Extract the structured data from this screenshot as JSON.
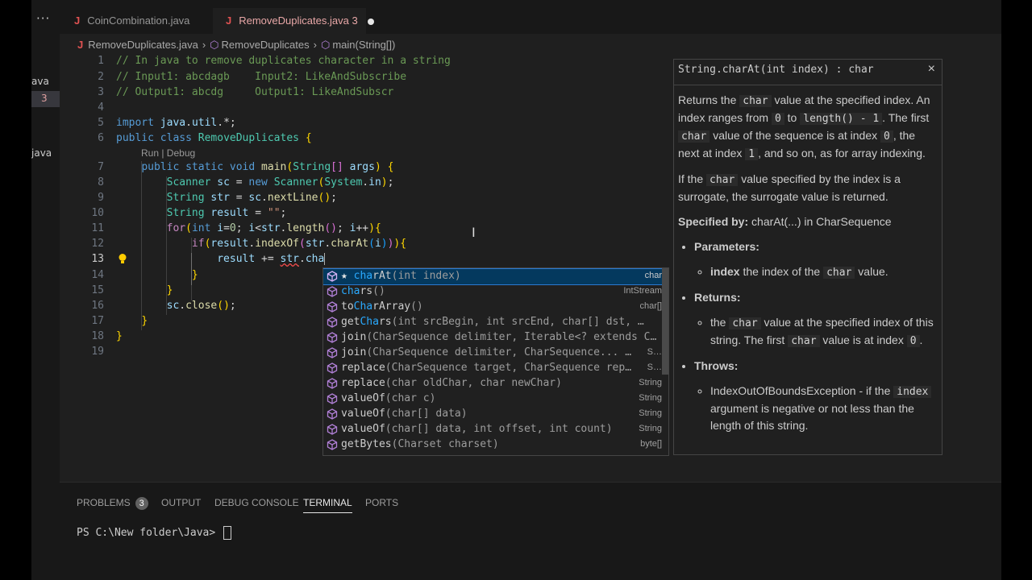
{
  "sidebar": {
    "more": "···",
    "items": [
      "ava",
      "3",
      "java"
    ]
  },
  "tabs": [
    {
      "label": "CoinCombination.java",
      "badge": ""
    },
    {
      "label": "RemoveDuplicates.java",
      "badge": "3"
    }
  ],
  "breadcrumb": {
    "file": "RemoveDuplicates.java",
    "class": "RemoveDuplicates",
    "method": "main(String[])"
  },
  "editor": {
    "line_numbers": [
      "1",
      "2",
      "3",
      "4",
      "5",
      "6",
      "7",
      "8",
      "9",
      "10",
      "11",
      "12",
      "13",
      "14",
      "15",
      "16",
      "17",
      "18",
      "19"
    ],
    "lines": [
      "// In java to remove duplicates character in a string",
      "// Input1: abcdagb    Input2: LikeAndSubscribe",
      "// Output1: abcdg     Output1: LikeAndSubscr",
      "",
      "import java.util.*;",
      "public class RemoveDuplicates {",
      "    public static void main(String[] args) {",
      "        Scanner sc = new Scanner(System.in);",
      "        String str = sc.nextLine();",
      "        String result = \"\";",
      "        for(int i=0; i<str.length(); i++){",
      "            if(result.indexOf(str.charAt(i))){",
      "                result += str.cha",
      "            }",
      "        }",
      "        sc.close();",
      "    }",
      "}",
      ""
    ],
    "codelens": "Run | Debug"
  },
  "suggest": {
    "items": [
      {
        "match": "charAt",
        "rest": "(int index)",
        "type": "char",
        "star": true
      },
      {
        "match": "chars",
        "rest": "()",
        "type": "IntStream"
      },
      {
        "match": "toCharArray",
        "rest": "()",
        "type": "char[]"
      },
      {
        "match": "getChars",
        "rest": "(int srcBegin, int srcEnd, char[] dst, …",
        "type": ""
      },
      {
        "match": "join",
        "rest": "(CharSequence delimiter, Iterable<? extends C…",
        "type": ""
      },
      {
        "match": "join",
        "rest": "(CharSequence delimiter, CharSequence... …",
        "type": "S…"
      },
      {
        "match": "replace",
        "rest": "(CharSequence target, CharSequence rep…",
        "type": "S…"
      },
      {
        "match": "replace",
        "rest": "(char oldChar, char newChar)",
        "type": "String"
      },
      {
        "match": "valueOf",
        "rest": "(char c)",
        "type": "String"
      },
      {
        "match": "valueOf",
        "rest": "(char[] data)",
        "type": "String"
      },
      {
        "match": "valueOf",
        "rest": "(char[] data, int offset, int count)",
        "type": "String"
      },
      {
        "match": "getBytes",
        "rest": "(Charset charset)",
        "type": "byte[]"
      }
    ]
  },
  "docs": {
    "signature": "String.charAt(int index) : char",
    "close": "×",
    "p1a": "Returns the ",
    "p1b": "char",
    "p1c": " value at the specified index. An index ranges from ",
    "p1d": "0",
    "p1e": " to ",
    "p1f": "length() - 1",
    "p1g": ". The first ",
    "p1h": "char",
    "p1i": " value of the sequence is at index ",
    "p1j": "0",
    "p1k": ", the next at index ",
    "p1l": "1",
    "p1m": ", and so on, as for array indexing.",
    "p2a": "If the ",
    "p2b": "char",
    "p2c": " value specified by the index is a surrogate, the surrogate value is returned.",
    "specified_label": "Specified by:",
    "specified_text": " charAt(...) in CharSequence",
    "params_label": "Parameters:",
    "param_name": "index",
    "param_a": " the index of the ",
    "param_b": "char",
    "param_c": " value.",
    "returns_label": "Returns:",
    "ret_a": "the ",
    "ret_b": "char",
    "ret_c": " value at the specified index of this string. The first ",
    "ret_d": "char",
    "ret_e": " value is at index ",
    "ret_f": "0",
    "ret_g": ".",
    "throws_label": "Throws:",
    "thr_a": "IndexOutOfBoundsException - if the ",
    "thr_b": "index",
    "thr_c": " argument is negative or not less than the length of this string."
  },
  "panel": {
    "tabs": [
      "PROBLEMS",
      "OUTPUT",
      "DEBUG CONSOLE",
      "TERMINAL",
      "PORTS"
    ],
    "problems_count": "3",
    "prompt": "PS C:\\New folder\\Java> "
  }
}
